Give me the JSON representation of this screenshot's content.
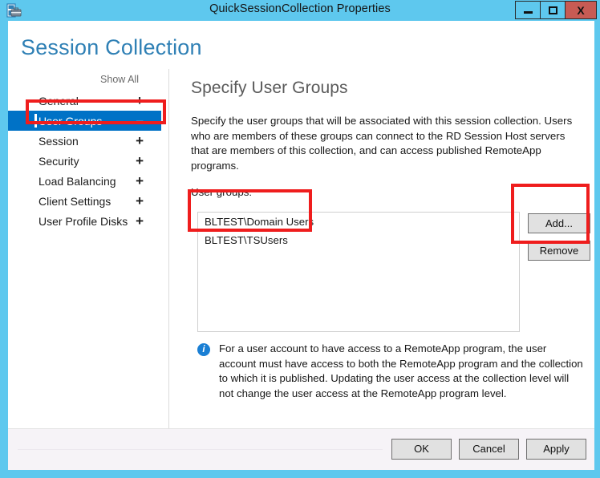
{
  "window": {
    "title": "QuickSessionCollection Properties",
    "icon": "rds-collection-icon",
    "controls": {
      "minimize": "minimize-icon",
      "maximize": "maximize-icon",
      "close": "X"
    }
  },
  "page": {
    "heading": "Session Collection"
  },
  "sidebar": {
    "show_all": "Show All",
    "items": [
      {
        "label": "General",
        "sign": "+",
        "selected": false
      },
      {
        "label": "User Groups",
        "sign": "–",
        "selected": true
      },
      {
        "label": "Session",
        "sign": "+",
        "selected": false
      },
      {
        "label": "Security",
        "sign": "+",
        "selected": false
      },
      {
        "label": "Load Balancing",
        "sign": "+",
        "selected": false
      },
      {
        "label": "Client Settings",
        "sign": "+",
        "selected": false
      },
      {
        "label": "User Profile Disks",
        "sign": "+",
        "selected": false
      }
    ]
  },
  "main": {
    "title": "Specify User Groups",
    "description": "Specify the user groups that will be associated with this session collection. Users who are members of these groups can connect to the RD Session Host servers that are members of this collection, and can access published RemoteApp programs.",
    "field_label": "User groups:",
    "user_groups": [
      "BLTEST\\Domain Users",
      "BLTEST\\TSUsers"
    ],
    "buttons": {
      "add": "Add...",
      "remove": "Remove"
    },
    "note": {
      "icon": "info-icon",
      "text": "For a user account to have access to a RemoteApp program, the user account must have access to both the RemoteApp program and the collection to which it is published. Updating the user access at the collection level will not change the user access at the RemoteApp program level."
    }
  },
  "footer": {
    "ok": "OK",
    "cancel": "Cancel",
    "apply": "Apply"
  },
  "colors": {
    "titlebar": "#5ec8ee",
    "accent_selected": "#0072c6",
    "heading": "#2f80b5",
    "close_button": "#c75b54",
    "annotation": "#ef1d1d",
    "info_icon": "#1a7fd4"
  }
}
